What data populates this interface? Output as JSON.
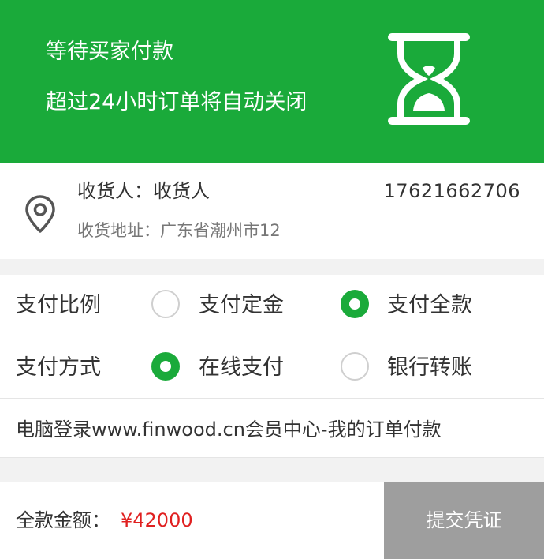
{
  "header": {
    "status": "等待买家付款",
    "notice": "超过24小时订单将自动关闭",
    "icon": "hourglass-icon",
    "bg_color": "#1aaa3a"
  },
  "address": {
    "consignee": "收货人：收货人",
    "phone": "17621662706",
    "address": "收货地址：广东省潮州市12",
    "icon": "location-pin-icon"
  },
  "payment_ratio": {
    "label": "支付比例",
    "options": [
      {
        "label": "支付定金",
        "selected": false
      },
      {
        "label": "支付全款",
        "selected": true
      }
    ]
  },
  "payment_method": {
    "label": "支付方式",
    "options": [
      {
        "label": "在线支付",
        "selected": true
      },
      {
        "label": "银行转账",
        "selected": false
      }
    ]
  },
  "info": {
    "text": "电脑登录www.finwood.cn会员中心-我的订单付款"
  },
  "footer": {
    "total_label": "全款金额：",
    "total_amount": "¥42000",
    "submit_label": "提交凭证",
    "amount_color": "#e02020"
  }
}
